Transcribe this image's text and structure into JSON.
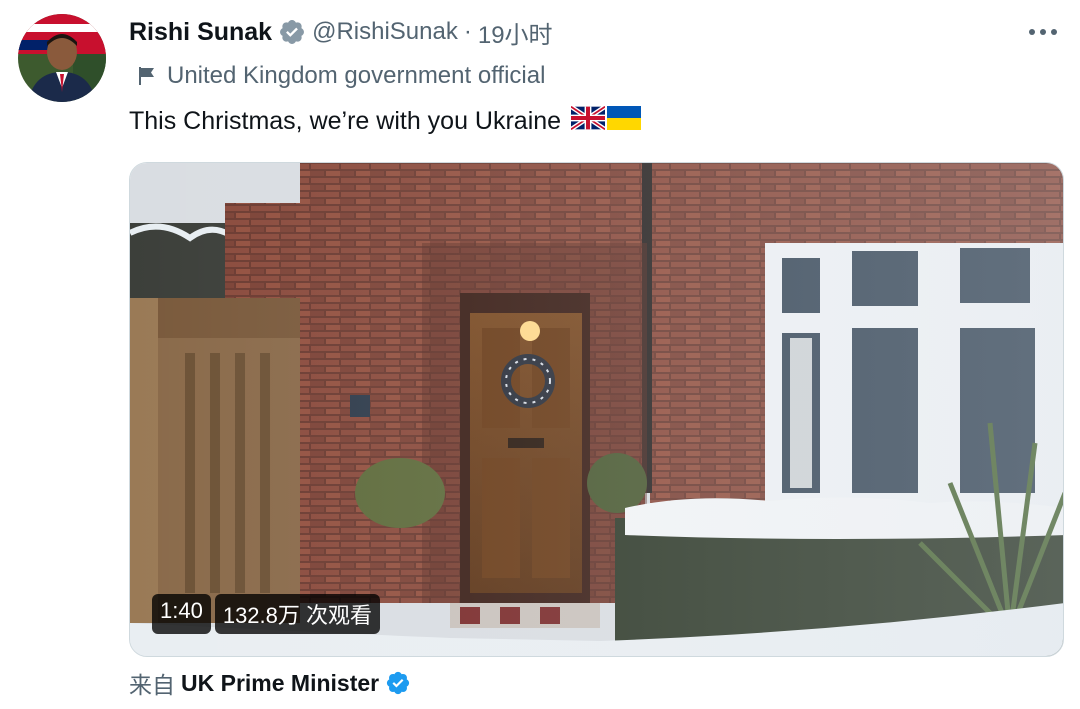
{
  "tweet": {
    "author_name": "Rishi Sunak",
    "handle": "@RishiSunak",
    "separator": "·",
    "time": "19小时",
    "gov_label": "United Kingdom government official",
    "text": "This Christmas, we’re with you Ukraine",
    "video": {
      "duration": "1:40",
      "views": "132.8万 次观看"
    },
    "source_prefix": "来自",
    "source_name": "UK Prime Minister"
  },
  "colors": {
    "verified_blue": "#1d9bf0",
    "secondary_text": "#536471"
  },
  "icons": {
    "verified": "verified-badge-icon",
    "flag": "flag-icon",
    "more": "more-horizontal-icon"
  }
}
